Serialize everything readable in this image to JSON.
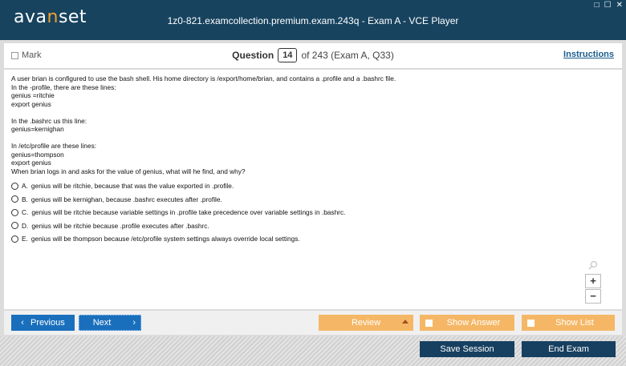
{
  "app": {
    "logo_prefix": "ava",
    "logo_accent": "n",
    "logo_suffix": "set",
    "window_title": "1z0-821.examcollection.premium.exam.243q - Exam A - VCE Player"
  },
  "window_controls": [
    "□",
    "☐",
    "✕"
  ],
  "question_bar": {
    "mark_label": "Mark",
    "question_label": "Question",
    "question_number": "14",
    "of_text": "of 243 (Exam A, Q33)",
    "instructions_label": "Instructions"
  },
  "question": {
    "lines1": [
      "A user brian is configured to use the bash shell. His home directory is /export/home/brian, and contains a .profile and a .bashrc file.",
      "In the -profile, there are these lines:",
      "genius =ritchie",
      "export genius"
    ],
    "lines2": [
      "In the .bashrc us this line:",
      "genius=kernighan"
    ],
    "lines3": [
      "In /etc/profile are these lines:",
      "genius=thompson",
      "export genius"
    ],
    "prompt": "When brian logs in and asks for the value of genius, what will he find, and why?",
    "options": [
      {
        "letter": "A.",
        "text": "genius will be ritchie, because that was the value exported in .profile."
      },
      {
        "letter": "B.",
        "text": "genius will be kernighan, because .bashrc executes after .profile."
      },
      {
        "letter": "C.",
        "text": "genius will be ritchie because variable settings in .profile take precedence over variable settings in .bashrc."
      },
      {
        "letter": "D.",
        "text": "genius will be ritchie because .profile executes after .bashrc."
      },
      {
        "letter": "E.",
        "text": "genius will be thompson because /etc/profile system settings always override local settings."
      }
    ]
  },
  "zoom": {
    "plus": "+",
    "minus": "−"
  },
  "nav": {
    "previous": "Previous",
    "next": "Next",
    "review": "Review",
    "show_answer": "Show Answer",
    "show_list": "Show List"
  },
  "footer": {
    "save_session": "Save Session",
    "end_exam": "End Exam"
  },
  "colors": {
    "titlebar": "#17435f",
    "logo_accent": "#f0a030",
    "nav_blue": "#1a6fbd",
    "nav_orange": "#f5b765",
    "footer_dark": "#173f5f"
  }
}
